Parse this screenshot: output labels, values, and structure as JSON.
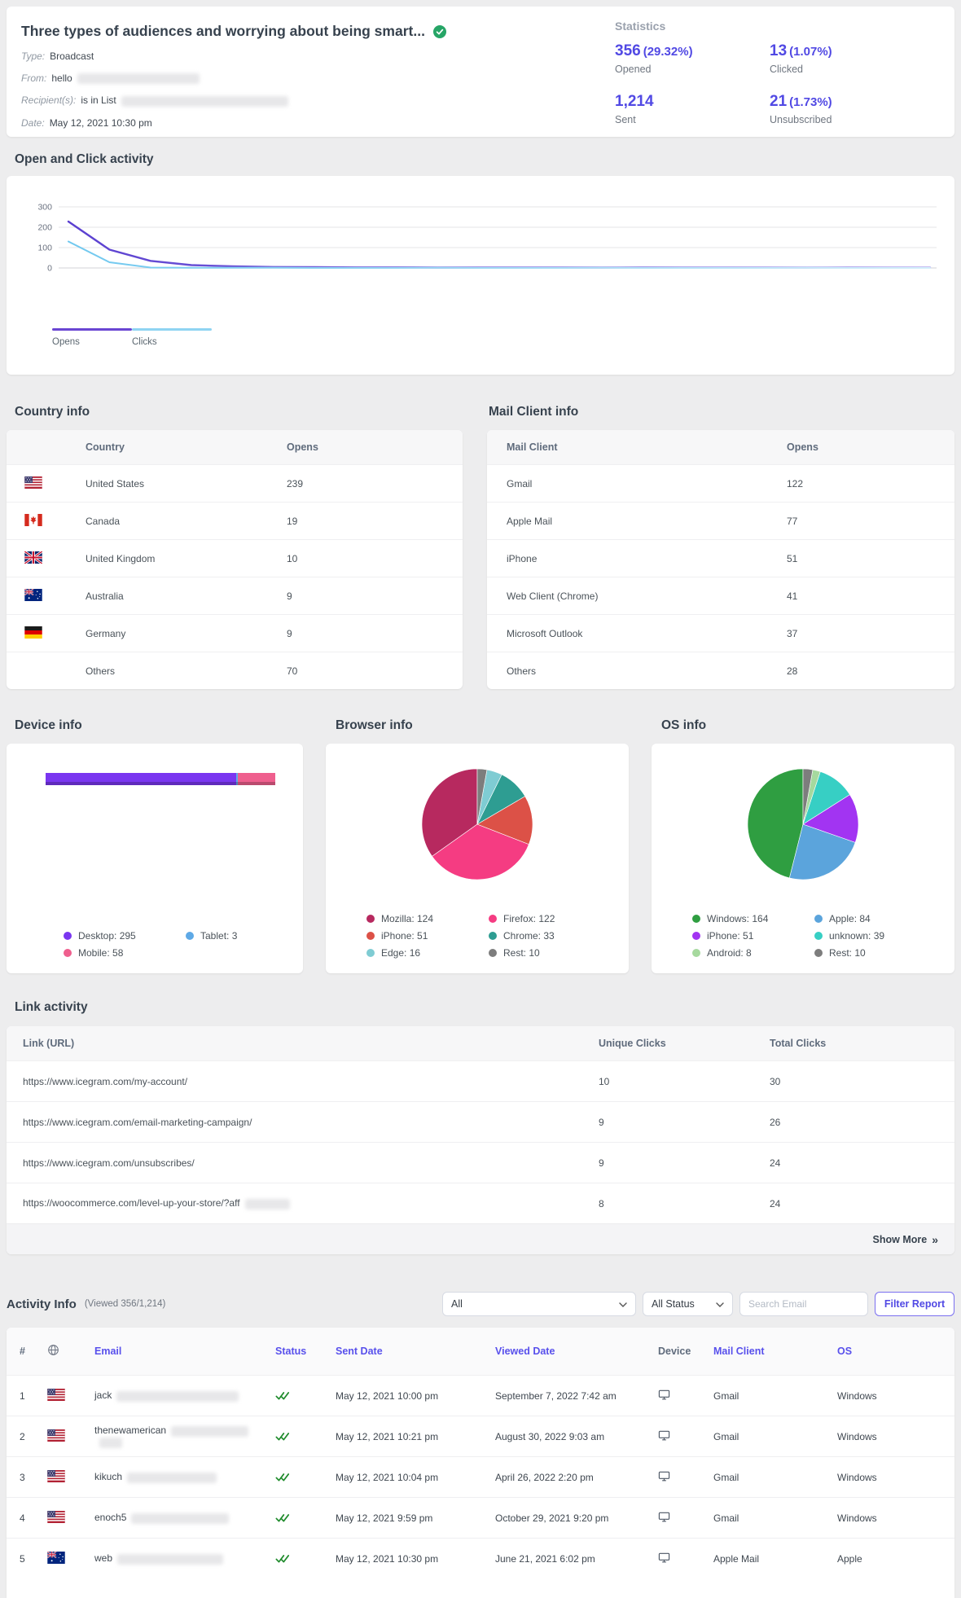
{
  "accent": "#5850ec",
  "header": {
    "title": "Three types of audiences and worrying about being smart...",
    "status_icon": "check-circle",
    "meta": [
      {
        "label": "Type:",
        "value": "Broadcast",
        "redact": 0
      },
      {
        "label": "From:",
        "value": "hello",
        "redact": 150
      },
      {
        "label": "Recipient(s):",
        "value": "is in List",
        "redact": 205
      },
      {
        "label": "Date:",
        "value": "May 12, 2021 10:30 pm",
        "redact": 0
      }
    ],
    "statistics": {
      "title": "Statistics",
      "items": [
        {
          "value": "356",
          "pct": "(29.32%)",
          "label": "Opened"
        },
        {
          "value": "13",
          "pct": "(1.07%)",
          "label": "Clicked"
        },
        {
          "value": "1,214",
          "pct": "",
          "label": "Sent"
        },
        {
          "value": "21",
          "pct": "(1.73%)",
          "label": "Unsubscribed"
        }
      ]
    }
  },
  "open_click": {
    "heading": "Open and Click activity",
    "yticks": [
      "300",
      "200",
      "100",
      "0"
    ],
    "legend": [
      {
        "label": "Opens",
        "color": "#6a45d2"
      },
      {
        "label": "Clicks",
        "color": "#8fd4f2"
      }
    ]
  },
  "chart_data": [
    {
      "type": "line",
      "title": "Open and Click activity",
      "xlabel": "",
      "ylabel": "",
      "ylim": [
        0,
        300
      ],
      "yticks": [
        300,
        200,
        100,
        0
      ],
      "grid": true,
      "legend_position": "bottom-left",
      "series": [
        {
          "name": "Opens",
          "color_start": "#5a3fd0",
          "color_end": "#b4a6ee",
          "values": [
            228,
            90,
            35,
            14,
            8,
            5,
            4,
            3,
            3,
            2,
            2,
            2,
            2,
            2,
            3,
            2,
            2,
            2,
            2,
            3,
            2,
            2
          ]
        },
        {
          "name": "Clicks",
          "color_start": "#70c8ef",
          "color_end": "#d5effb",
          "values": [
            130,
            28,
            2,
            1,
            1,
            1,
            0,
            0,
            0,
            1,
            0,
            0,
            0,
            1,
            0,
            0,
            0,
            0,
            1,
            0,
            0,
            0
          ]
        }
      ]
    },
    {
      "type": "bar",
      "title": "Device info",
      "orientation": "horizontal-stacked",
      "categories": [
        "Desktop",
        "Tablet",
        "Mobile"
      ],
      "values": [
        295,
        3,
        58
      ],
      "colors": [
        "#7a36f0",
        "#5ea9e6",
        "#ef5f8e"
      ]
    },
    {
      "type": "pie",
      "title": "Browser info",
      "labels": [
        "Mozilla",
        "Firefox",
        "iPhone",
        "Chrome",
        "Edge",
        "Rest"
      ],
      "values": [
        124,
        122,
        51,
        33,
        16,
        10
      ],
      "colors": [
        "#b7295f",
        "#f53c82",
        "#dc5147",
        "#2e9d92",
        "#7fccd3",
        "#7d7d7d"
      ]
    },
    {
      "type": "pie",
      "title": "OS info",
      "labels": [
        "Windows",
        "Apple",
        "iPhone",
        "unknown",
        "Android",
        "Rest"
      ],
      "values": [
        164,
        84,
        51,
        39,
        8,
        10
      ],
      "colors": [
        "#2f9e41",
        "#5ba4dc",
        "#a234f2",
        "#37cfc4",
        "#a6d99e",
        "#7d7d7d"
      ]
    }
  ],
  "country_info": {
    "heading": "Country info",
    "columns": [
      "Country",
      "Opens"
    ],
    "rows": [
      {
        "flag": "us",
        "country": "United States",
        "opens": "239"
      },
      {
        "flag": "ca",
        "country": "Canada",
        "opens": "19"
      },
      {
        "flag": "gb",
        "country": "United Kingdom",
        "opens": "10"
      },
      {
        "flag": "au",
        "country": "Australia",
        "opens": "9"
      },
      {
        "flag": "de",
        "country": "Germany",
        "opens": "9"
      },
      {
        "flag": "",
        "country": "Others",
        "opens": "70"
      }
    ]
  },
  "mail_client_info": {
    "heading": "Mail Client info",
    "columns": [
      "Mail Client",
      "Opens"
    ],
    "rows": [
      {
        "client": "Gmail",
        "opens": "122"
      },
      {
        "client": "Apple Mail",
        "opens": "77"
      },
      {
        "client": "iPhone",
        "opens": "51"
      },
      {
        "client": "Web Client (Chrome)",
        "opens": "41"
      },
      {
        "client": "Microsoft Outlook",
        "opens": "37"
      },
      {
        "client": "Others",
        "opens": "28"
      }
    ]
  },
  "device_info": {
    "heading": "Device info",
    "legend": [
      {
        "label": "Desktop: 295",
        "color": "#7a36f0"
      },
      {
        "label": "Tablet: 3",
        "color": "#5ea9e6"
      },
      {
        "label": "Mobile: 58",
        "color": "#ef5f8e"
      }
    ]
  },
  "browser_info": {
    "heading": "Browser info",
    "legend": [
      {
        "label": "Mozilla: 124",
        "color": "#b7295f"
      },
      {
        "label": "Firefox: 122",
        "color": "#f53c82"
      },
      {
        "label": "iPhone: 51",
        "color": "#dc5147"
      },
      {
        "label": "Chrome: 33",
        "color": "#2e9d92"
      },
      {
        "label": "Edge: 16",
        "color": "#7fccd3"
      },
      {
        "label": "Rest: 10",
        "color": "#7d7d7d"
      }
    ]
  },
  "os_info": {
    "heading": "OS info",
    "legend": [
      {
        "label": "Windows: 164",
        "color": "#2f9e41"
      },
      {
        "label": "Apple: 84",
        "color": "#5ba4dc"
      },
      {
        "label": "iPhone: 51",
        "color": "#a234f2"
      },
      {
        "label": "unknown: 39",
        "color": "#37cfc4"
      },
      {
        "label": "Android: 8",
        "color": "#a6d99e"
      },
      {
        "label": "Rest: 10",
        "color": "#7d7d7d"
      }
    ]
  },
  "link_activity": {
    "heading": "Link activity",
    "columns": [
      "Link (URL)",
      "Unique Clicks",
      "Total Clicks"
    ],
    "rows": [
      {
        "url": "https://www.icegram.com/my-account/",
        "unique": "10",
        "total": "30",
        "redact": 0
      },
      {
        "url": "https://www.icegram.com/email-marketing-campaign/",
        "unique": "9",
        "total": "26",
        "redact": 0
      },
      {
        "url": "https://www.icegram.com/unsubscribes/",
        "unique": "9",
        "total": "24",
        "redact": 0
      },
      {
        "url": "https://woocommerce.com/level-up-your-store/?aff",
        "unique": "8",
        "total": "24",
        "redact": 55
      }
    ],
    "show_more": "Show More"
  },
  "activity": {
    "heading": "Activity Info",
    "viewed": "(Viewed 356/1,214)",
    "filters": {
      "list_value": "All",
      "status_value": "All Status",
      "search_placeholder": "Search Email",
      "button_label": "Filter Report"
    },
    "columns": [
      {
        "label": "#",
        "accent": false,
        "icon": ""
      },
      {
        "label": "",
        "accent": false,
        "icon": "globe"
      },
      {
        "label": "Email",
        "accent": true,
        "icon": ""
      },
      {
        "label": "Status",
        "accent": true,
        "icon": ""
      },
      {
        "label": "Sent Date",
        "accent": true,
        "icon": ""
      },
      {
        "label": "Viewed Date",
        "accent": true,
        "icon": ""
      },
      {
        "label": "Device",
        "accent": false,
        "icon": ""
      },
      {
        "label": "Mail Client",
        "accent": true,
        "icon": ""
      },
      {
        "label": "OS",
        "accent": true,
        "icon": ""
      }
    ],
    "rows": [
      {
        "n": "1",
        "flag": "us",
        "email": "jack",
        "redact": 150,
        "redact2": 0,
        "status": "opened",
        "sent": "May 12, 2021 10:00 pm",
        "viewed": "September 7, 2022 7:42 am",
        "device": "desktop",
        "client": "Gmail",
        "os": "Windows"
      },
      {
        "n": "2",
        "flag": "us",
        "email": "thenewamerican",
        "redact": 95,
        "redact2": 28,
        "status": "opened",
        "sent": "May 12, 2021 10:21 pm",
        "viewed": "August 30, 2022 9:03 am",
        "device": "desktop",
        "client": "Gmail",
        "os": "Windows"
      },
      {
        "n": "3",
        "flag": "us",
        "email": "kikuch",
        "redact": 110,
        "redact2": 0,
        "status": "opened",
        "sent": "May 12, 2021 10:04 pm",
        "viewed": "April 26, 2022 2:20 pm",
        "device": "desktop",
        "client": "Gmail",
        "os": "Windows"
      },
      {
        "n": "4",
        "flag": "us",
        "email": "enoch5",
        "redact": 120,
        "redact2": 0,
        "status": "opened",
        "sent": "May 12, 2021 9:59 pm",
        "viewed": "October 29, 2021 9:20 pm",
        "device": "desktop",
        "client": "Gmail",
        "os": "Windows"
      },
      {
        "n": "5",
        "flag": "au",
        "email": "web",
        "redact": 130,
        "redact2": 0,
        "status": "opened",
        "sent": "May 12, 2021 10:30 pm",
        "viewed": "June 21, 2021 6:02 pm",
        "device": "desktop",
        "client": "Apple Mail",
        "os": "Apple"
      }
    ]
  }
}
